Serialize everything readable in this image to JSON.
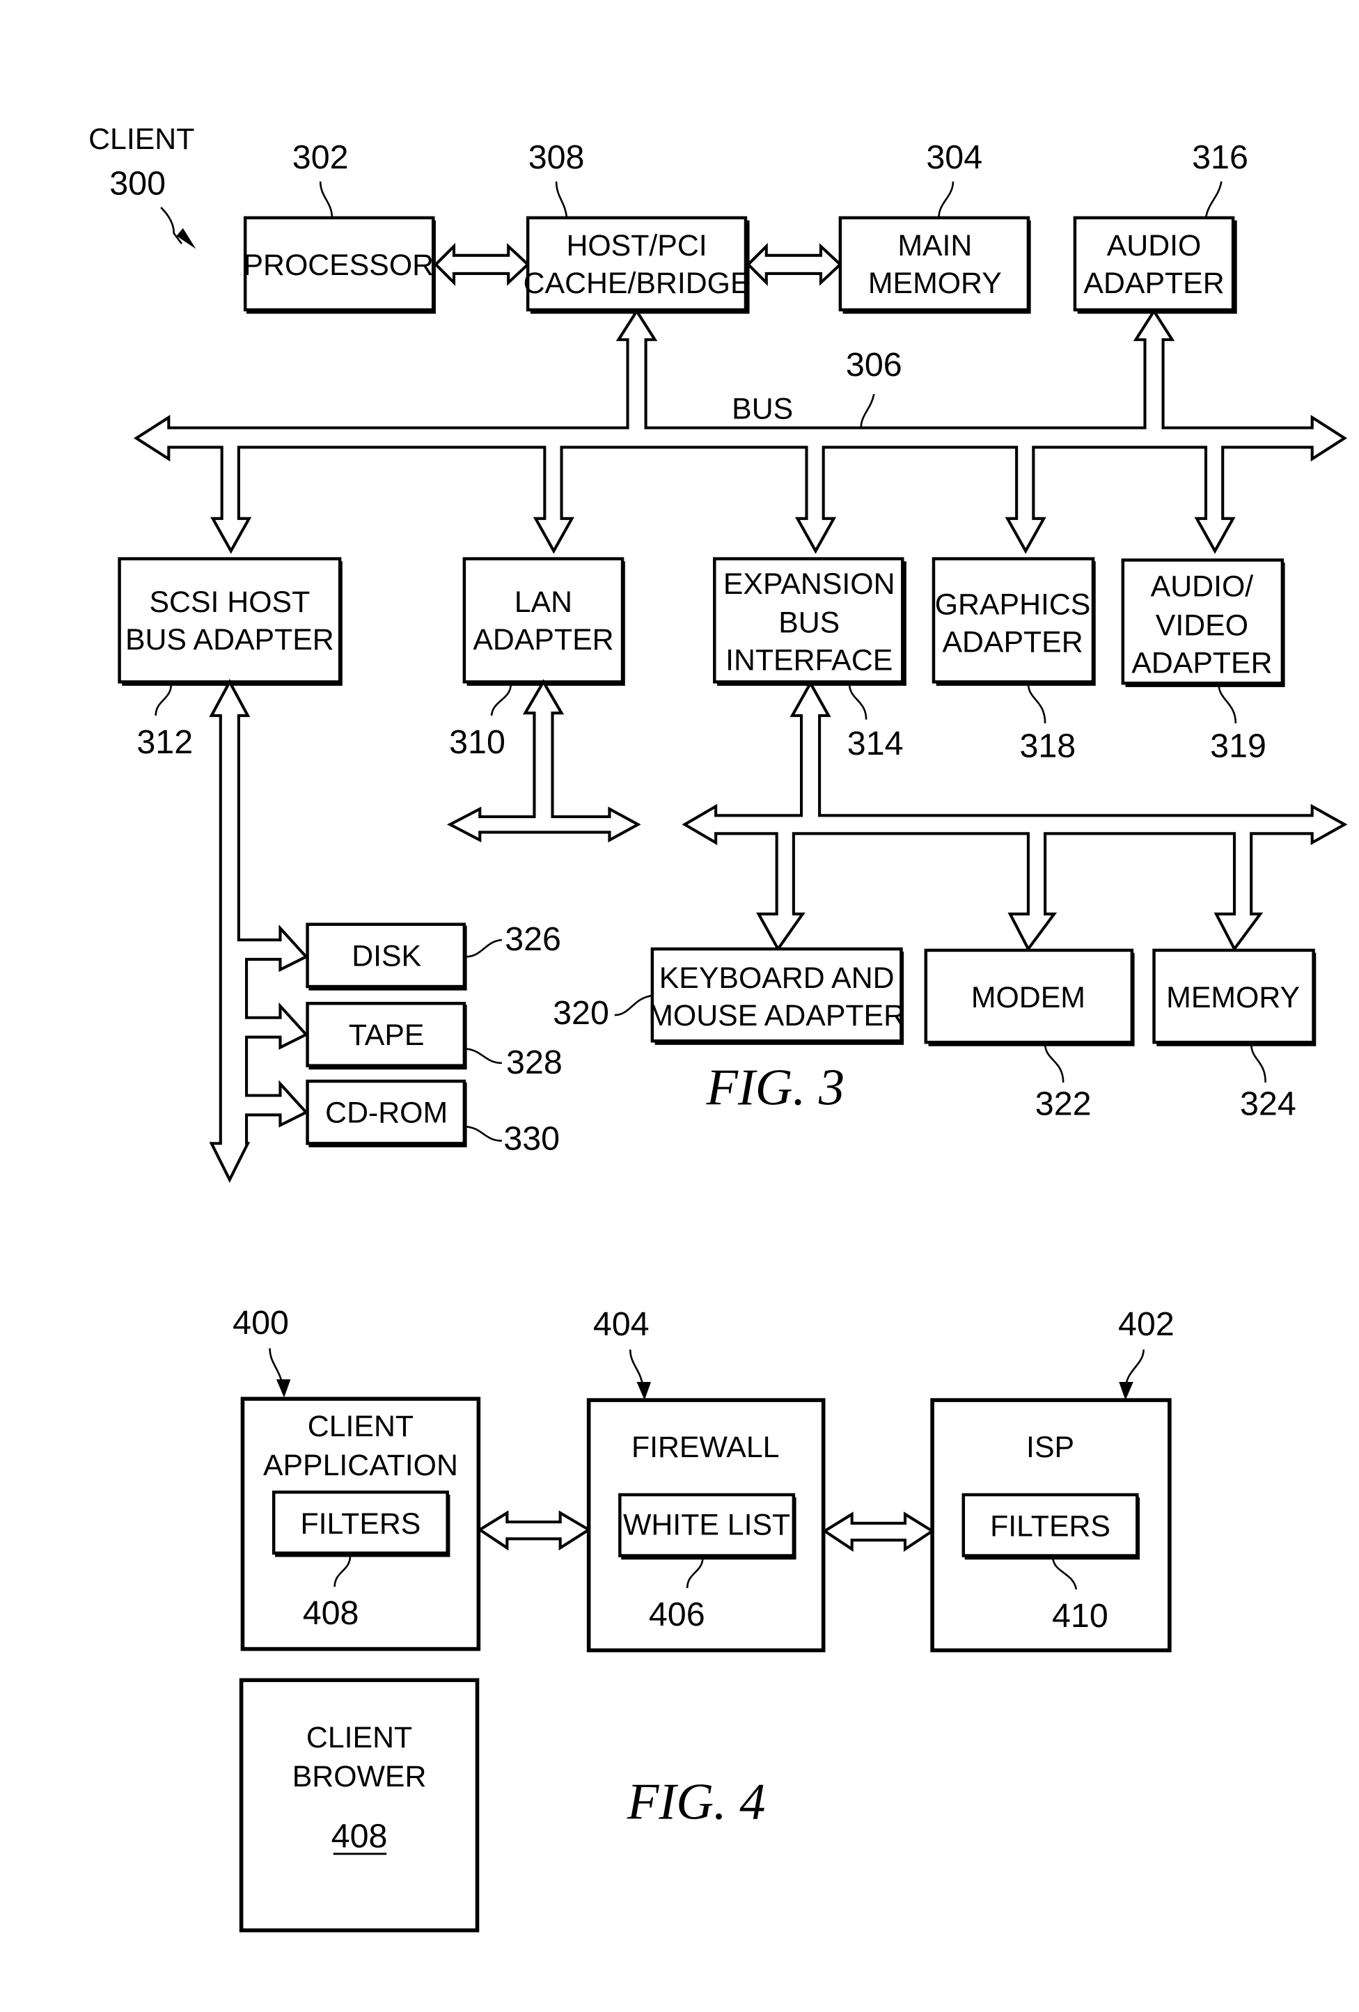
{
  "fig3": {
    "caption": "FIG. 3",
    "client_label": "CLIENT",
    "client_ref": "300",
    "bus_label": "BUS",
    "bus_ref": "306",
    "components": {
      "processor": {
        "lines": [
          "PROCESSOR"
        ],
        "ref": "302"
      },
      "host_bridge": {
        "lines": [
          "HOST/PCI",
          "CACHE/BRIDGE"
        ],
        "ref": "308"
      },
      "main_memory": {
        "lines": [
          "MAIN",
          "MEMORY"
        ],
        "ref": "304"
      },
      "audio_adapter": {
        "lines": [
          "AUDIO",
          "ADAPTER"
        ],
        "ref": "316"
      },
      "scsi": {
        "lines": [
          "SCSI HOST",
          "BUS ADAPTER"
        ],
        "ref": "312"
      },
      "lan": {
        "lines": [
          "LAN",
          "ADAPTER"
        ],
        "ref": "310"
      },
      "expansion": {
        "lines": [
          "EXPANSION",
          "BUS",
          "INTERFACE"
        ],
        "ref": "314"
      },
      "graphics": {
        "lines": [
          "GRAPHICS",
          "ADAPTER"
        ],
        "ref": "318"
      },
      "av": {
        "lines": [
          "AUDIO/",
          "VIDEO",
          "ADAPTER"
        ],
        "ref": "319"
      },
      "disk": {
        "lines": [
          "DISK"
        ],
        "ref": "326"
      },
      "tape": {
        "lines": [
          "TAPE"
        ],
        "ref": "328"
      },
      "cdrom": {
        "lines": [
          "CD-ROM"
        ],
        "ref": "330"
      },
      "keyboard": {
        "lines": [
          "KEYBOARD AND",
          "MOUSE ADAPTER"
        ],
        "ref": "320"
      },
      "modem": {
        "lines": [
          "MODEM"
        ],
        "ref": "322"
      },
      "memory": {
        "lines": [
          "MEMORY"
        ],
        "ref": "324"
      }
    }
  },
  "fig4": {
    "caption": "FIG. 4",
    "client_app": {
      "lines": [
        "CLIENT",
        "APPLICATION"
      ],
      "ref": "400",
      "inner": "FILTERS",
      "inner_ref": "408"
    },
    "firewall": {
      "lines": [
        "FIREWALL"
      ],
      "ref": "404",
      "inner": "WHITE LIST",
      "inner_ref": "406"
    },
    "isp": {
      "lines": [
        "ISP"
      ],
      "ref": "402",
      "inner": "FILTERS",
      "inner_ref": "410"
    },
    "client_browser": {
      "lines": [
        "CLIENT",
        "BROWER"
      ],
      "ref": "408"
    }
  }
}
